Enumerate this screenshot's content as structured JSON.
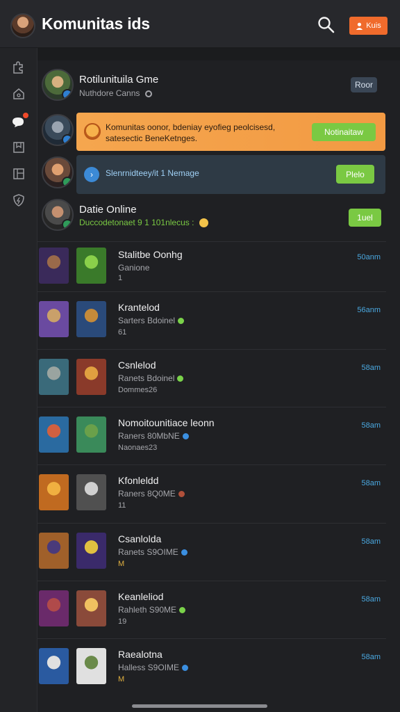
{
  "header": {
    "title": "Komunitas ids",
    "action_label": "Kuis"
  },
  "sidebar": {
    "items": [
      {
        "name": "sidebar-item-puzzle",
        "icon": "puzzle-icon"
      },
      {
        "name": "sidebar-item-home",
        "icon": "home-icon"
      },
      {
        "name": "sidebar-item-chat",
        "icon": "chat-bubble-icon",
        "active": true
      },
      {
        "name": "sidebar-item-bookmark",
        "icon": "bookmark-icon"
      },
      {
        "name": "sidebar-item-library",
        "icon": "library-icon"
      },
      {
        "name": "sidebar-item-shield",
        "icon": "shield-icon"
      }
    ]
  },
  "feed": {
    "item1": {
      "title": "Rotilunituila Gme",
      "subtitle": "Nuthdore Canns",
      "button": "Roor"
    },
    "item2": {
      "text_line1": "Komunitas oonor, bdeniay eyofieg peolcisesd,",
      "text_line2": "satesectic BeneKetnges.",
      "button": "Notinaitaw"
    },
    "item3": {
      "text": "Slenrnidteey/it 1 Nemage",
      "button": "Plelo"
    },
    "item4": {
      "title": "Datie Online",
      "subtitle": "Duccodetonaet 9 1 101nlecus :",
      "button": "1uel"
    }
  },
  "games": [
    {
      "title": "Stalitbe Oonhg",
      "sub": "Ganione",
      "extra": "1",
      "right": "50anm",
      "gem": "#ffffff00"
    },
    {
      "title": "Krantelod",
      "sub": "Sarters Bdoinel",
      "extra": "61",
      "right": "56anm",
      "gem": "#7ad24a"
    },
    {
      "title": "Csnlelod",
      "sub": "Ranets Bdoinel",
      "extra": "Dommes26",
      "right": "58am",
      "gem": "#7ad24a"
    },
    {
      "title": "Nomoitounitiace leonn",
      "sub": "Raners 80MbNE",
      "extra": "Naonaes23",
      "right": "58am",
      "gem": "#3b8fe0"
    },
    {
      "title": "Kfonleldd",
      "sub": "Raners 8Q0ME",
      "extra": "11",
      "right": "58am",
      "gem": "#b0503a"
    },
    {
      "title": "Csanlolda",
      "sub": "Ranets S9OIME",
      "extra": "M",
      "right": "58am",
      "gem": "#3b8fe0"
    },
    {
      "title": "Keanleliod",
      "sub": "Rahleth S90ME",
      "extra": "19",
      "right": "58am",
      "gem": "#7ad24a"
    },
    {
      "title": "Raealotna",
      "sub": "Halless S9OIME",
      "extra": "M",
      "right": "58am",
      "gem": "#3b8fe0"
    }
  ],
  "colors": {
    "accent_orange": "#f06b2c",
    "notice_orange": "#f5a04a",
    "notice_blue": "#2f3a44",
    "button_green": "#7ac943",
    "link_blue": "#4aa8e0"
  }
}
